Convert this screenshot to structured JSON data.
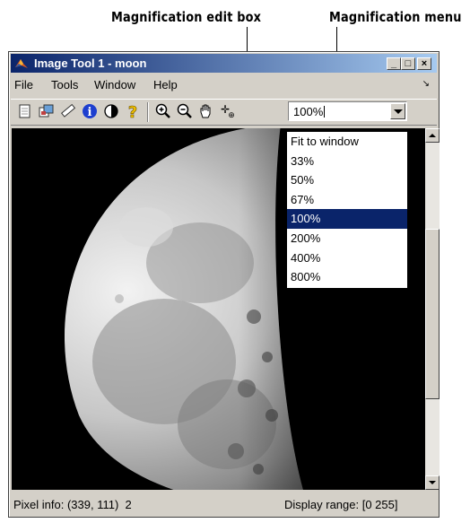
{
  "callouts": {
    "edit_box": "Magnification edit box",
    "menu": "Magnification menu"
  },
  "window": {
    "title": "Image Tool 1 - moon",
    "caption_buttons": [
      "_",
      "□",
      "×"
    ]
  },
  "menubar": {
    "items": [
      "File",
      "Tools",
      "Window",
      "Help"
    ],
    "dock_glyph": "↘"
  },
  "toolbar": {
    "icons": [
      "new-figure-icon",
      "export-icon",
      "ruler-icon",
      "info-icon",
      "contrast-icon",
      "help-icon",
      "zoom-in-icon",
      "zoom-out-icon",
      "pan-hand-icon",
      "pixel-region-icon"
    ],
    "info_glyph": "i",
    "help_glyph": "?",
    "pixel_region_glyph": "✛",
    "pixel_region_sub": "⊕"
  },
  "magnification": {
    "value": "100%",
    "options": [
      "Fit to window",
      "33%",
      "50%",
      "67%",
      "100%",
      "200%",
      "400%",
      "800%"
    ],
    "selected": "100%"
  },
  "status": {
    "pixel_info": "Pixel info: (339, 111)  2",
    "display_range": "Display range: [0 255]"
  },
  "colors": {
    "title_start": "#0a246a",
    "title_end": "#a6caf0",
    "selection": "#0a246a",
    "chrome": "#d4d0c8"
  }
}
